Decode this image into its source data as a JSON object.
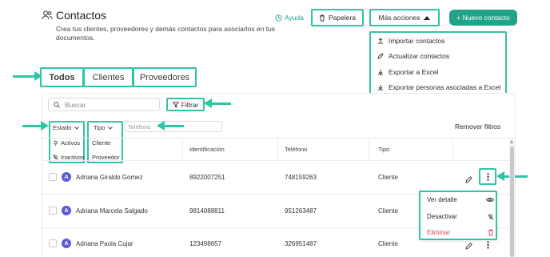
{
  "header": {
    "title": "Contactos",
    "description_line1": "Crea tus clientes, proveedores y demás contactos para asociarlos en tus",
    "description_line2": "documentos.",
    "help_label": "Ayuda",
    "trash_label": "Papelera",
    "more_actions_label": "Más acciones",
    "new_contact_label": "+ Nuevo contacto"
  },
  "more_actions_menu": {
    "items": [
      {
        "label": "Importar contactos",
        "icon": "upload-icon"
      },
      {
        "label": "Actualizar contactos",
        "icon": "edit-icon"
      },
      {
        "label": "Exportar a Excel",
        "icon": "download-icon"
      },
      {
        "label": "Exportar personas asociadas a Excel",
        "icon": "download-icon"
      }
    ]
  },
  "tabs": [
    {
      "label": "Todos",
      "active": true
    },
    {
      "label": "Clientes",
      "active": false
    },
    {
      "label": "Proveedores",
      "active": false
    }
  ],
  "search": {
    "placeholder": "Buscar"
  },
  "filter_button_label": "Filtrar",
  "filters": {
    "estado_label": "Estado",
    "estado_options": [
      "Activos",
      "Inactivos"
    ],
    "tipo_label": "Tipo",
    "tipo_options": [
      "Cliente",
      "Proveedor"
    ],
    "telefono_placeholder": "Teléfono",
    "remove_label": "Remover filtros"
  },
  "table": {
    "columns": [
      "Identificación",
      "Teléfono",
      "Tipo"
    ],
    "rows": [
      {
        "initial": "A",
        "name": "Adriana Giraldo Gomez",
        "id": "8922007251",
        "phone": "748159263",
        "type": "Cliente"
      },
      {
        "initial": "A",
        "name": "Adriana Marcela Salgado",
        "id": "9814088811",
        "phone": "951263487",
        "type": "Cliente"
      },
      {
        "initial": "A",
        "name": "Adriana Paola Cujar",
        "id": "123498657",
        "phone": "326951487",
        "type": "Cliente"
      }
    ]
  },
  "row_menu": {
    "items": [
      {
        "label": "Ver detalle",
        "icon": "eye-icon"
      },
      {
        "label": "Desactivar",
        "icon": "deactivate-icon"
      },
      {
        "label": "Eliminar",
        "icon": "trash-icon"
      }
    ]
  },
  "colors": {
    "accent": "#2ec4a6",
    "brand_green": "#21a38a",
    "danger": "#e0455a",
    "avatar": "#5b5bd6"
  }
}
